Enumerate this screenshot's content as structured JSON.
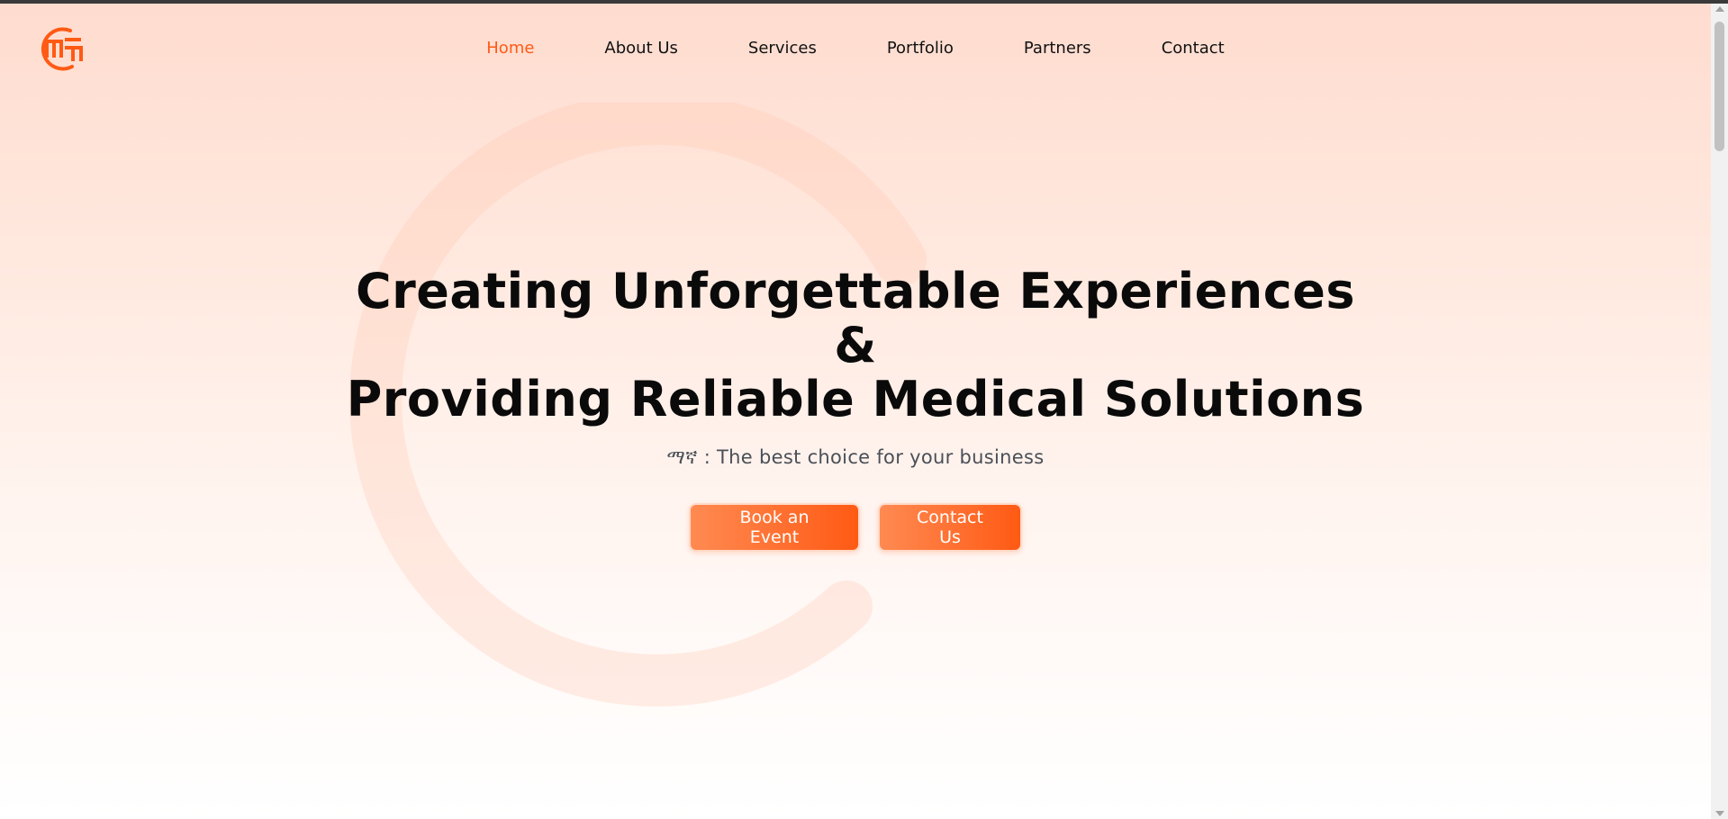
{
  "brand": {
    "logo_icon": "brand-logo-icon",
    "accent_color": "#ff5a14"
  },
  "nav": {
    "items": [
      {
        "label": "Home",
        "active": true
      },
      {
        "label": "About Us",
        "active": false
      },
      {
        "label": "Services",
        "active": false
      },
      {
        "label": "Portfolio",
        "active": false
      },
      {
        "label": "Partners",
        "active": false
      },
      {
        "label": "Contact",
        "active": false
      }
    ]
  },
  "hero": {
    "title_line1": "Creating Unforgettable Experiences",
    "title_line2": "&",
    "title_line3": "Providing Reliable Medical Solutions",
    "subtitle": "ማኛ : The best choice for your business",
    "primary_button": "Book an Event",
    "secondary_button": "Contact Us"
  },
  "colors": {
    "background_top": "#ffdccf",
    "background_bottom": "#ffffff",
    "title_text": "#0a0a0a",
    "subtitle_text": "#4a4f57"
  }
}
